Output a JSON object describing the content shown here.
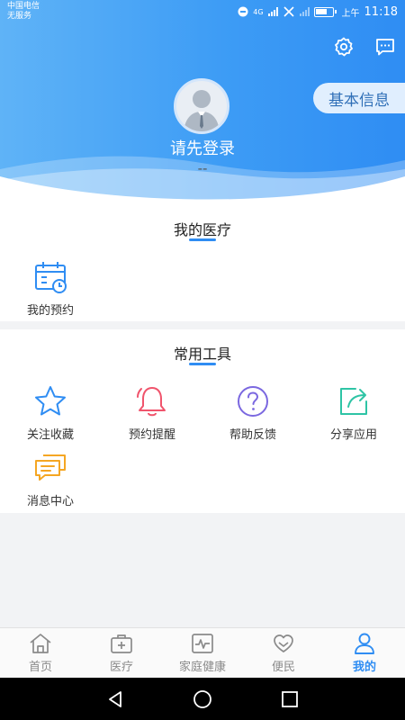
{
  "status_bar": {
    "carrier_line1": "中国电信",
    "carrier_line2": "无服务",
    "network": "4G",
    "time_prefix": "上午",
    "time": "11:18"
  },
  "header": {
    "basic_info_label": "基本信息",
    "login_prompt": "请先登录",
    "login_subtext": "--",
    "icons": [
      "gear-icon",
      "message-icon"
    ]
  },
  "medical": {
    "title": "我的医疗",
    "items": [
      {
        "label": "我的预约",
        "icon": "calendar-clock-icon"
      }
    ]
  },
  "tools": {
    "title": "常用工具",
    "items": [
      {
        "label": "关注收藏",
        "icon": "star-icon",
        "color": "#2f8df3"
      },
      {
        "label": "预约提醒",
        "icon": "bell-icon",
        "color": "#f0546c"
      },
      {
        "label": "帮助反馈",
        "icon": "question-circle-icon",
        "color": "#7b68e0"
      },
      {
        "label": "分享应用",
        "icon": "share-icon",
        "color": "#2ec4a5"
      },
      {
        "label": "消息中心",
        "icon": "chat-bubbles-icon",
        "color": "#f5a623"
      }
    ]
  },
  "bottom_nav": {
    "active_index": 4,
    "items": [
      {
        "label": "首页",
        "icon": "home-icon"
      },
      {
        "label": "医疗",
        "icon": "medical-kit-icon"
      },
      {
        "label": "家庭健康",
        "icon": "heartbeat-monitor-icon"
      },
      {
        "label": "便民",
        "icon": "heart-hands-icon"
      },
      {
        "label": "我的",
        "icon": "user-icon"
      }
    ]
  },
  "colors": {
    "accent": "#2f8df3",
    "header_gradient_start": "#5fb3f7",
    "header_gradient_end": "#2f8df3"
  }
}
